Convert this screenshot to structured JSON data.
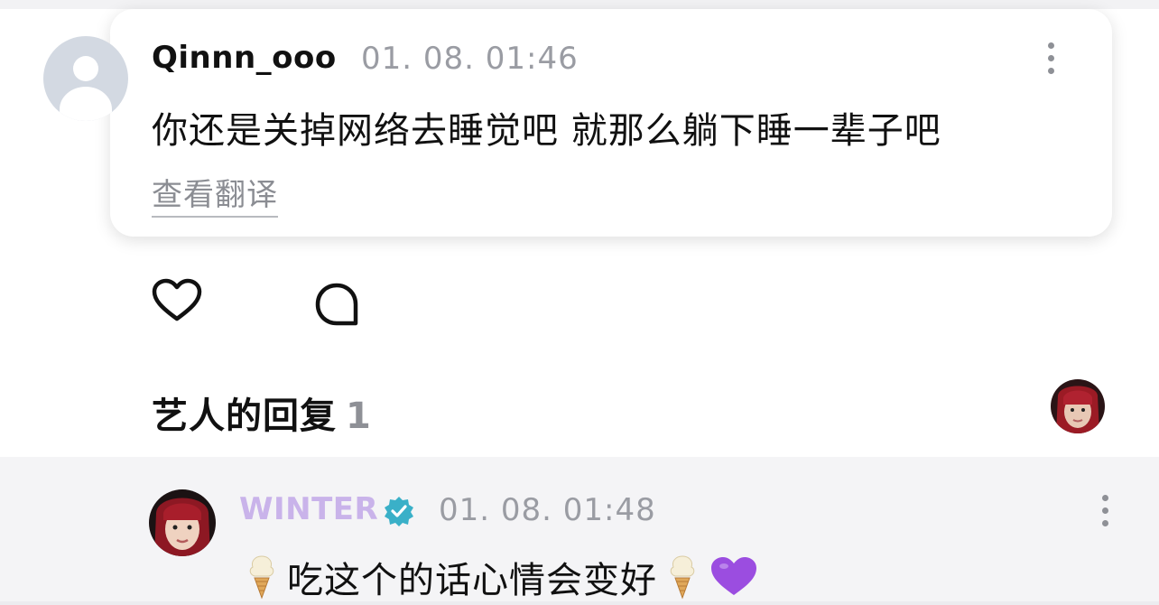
{
  "comment": {
    "username": "Qinnn_ooo",
    "timestamp": "01. 08. 01:46",
    "text": "你还是关掉网络去睡觉吧 就那么躺下睡一辈子吧",
    "translate_label": "查看翻译",
    "more_icon": "more-vertical-icon"
  },
  "actions": {
    "like_icon": "heart-icon",
    "reply_icon": "comment-bubble-icon"
  },
  "artist_replies": {
    "label": "艺人的回复",
    "count": "1"
  },
  "reply": {
    "username": "WINTER",
    "verified_icon": "verified-badge-icon",
    "timestamp": "01. 08. 01:48",
    "emoji_start": "🍦",
    "text": "吃这个的话心情会变好",
    "emoji_end": "🍦",
    "emoji_heart": "💜",
    "more_icon": "more-vertical-icon"
  },
  "colors": {
    "username_artist": "#c9b3ea",
    "verified": "#3ab0c8",
    "timestamp": "#9a9ca3",
    "purple_heart": "#9b4de0"
  }
}
